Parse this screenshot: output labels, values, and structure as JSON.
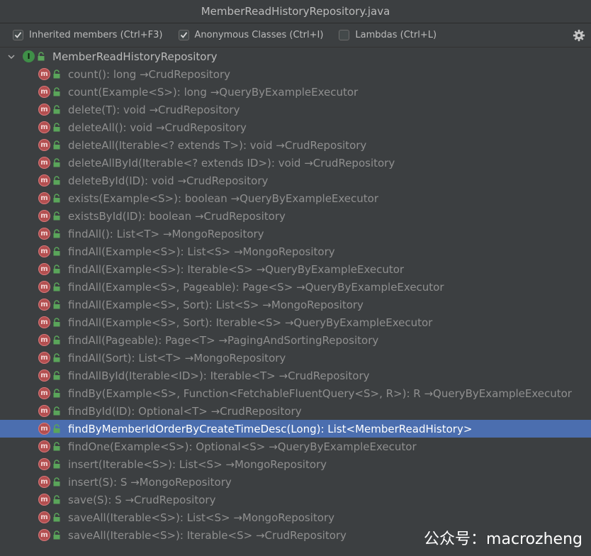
{
  "window": {
    "title": "MemberReadHistoryRepository.java"
  },
  "toolbar": {
    "options": [
      {
        "label": "Inherited members (Ctrl+F3)",
        "checked": true
      },
      {
        "label": "Anonymous Classes (Ctrl+I)",
        "checked": true
      },
      {
        "label": "Lambdas (Ctrl+L)",
        "checked": false
      }
    ],
    "settings_icon": "gear-icon"
  },
  "tree": {
    "root": {
      "label": "MemberReadHistoryRepository",
      "icon": "interface-icon",
      "expanded": true
    },
    "methods": [
      {
        "label": "count(): long →CrudRepository"
      },
      {
        "label": "count(Example<S>): long →QueryByExampleExecutor"
      },
      {
        "label": "delete(T): void →CrudRepository"
      },
      {
        "label": "deleteAll(): void →CrudRepository"
      },
      {
        "label": "deleteAll(Iterable<? extends T>): void →CrudRepository"
      },
      {
        "label": "deleteAllById(Iterable<? extends ID>): void →CrudRepository"
      },
      {
        "label": "deleteById(ID): void →CrudRepository"
      },
      {
        "label": "exists(Example<S>): boolean →QueryByExampleExecutor"
      },
      {
        "label": "existsById(ID): boolean →CrudRepository"
      },
      {
        "label": "findAll(): List<T> →MongoRepository"
      },
      {
        "label": "findAll(Example<S>): List<S> →MongoRepository"
      },
      {
        "label": "findAll(Example<S>): Iterable<S> →QueryByExampleExecutor"
      },
      {
        "label": "findAll(Example<S>, Pageable): Page<S> →QueryByExampleExecutor"
      },
      {
        "label": "findAll(Example<S>, Sort): List<S> →MongoRepository"
      },
      {
        "label": "findAll(Example<S>, Sort): Iterable<S> →QueryByExampleExecutor"
      },
      {
        "label": "findAll(Pageable): Page<T> →PagingAndSortingRepository"
      },
      {
        "label": "findAll(Sort): List<T> →MongoRepository"
      },
      {
        "label": "findAllById(Iterable<ID>): Iterable<T> →CrudRepository"
      },
      {
        "label": "findBy(Example<S>, Function<FetchableFluentQuery<S>, R>): R →QueryByExampleExecutor"
      },
      {
        "label": "findById(ID): Optional<T> →CrudRepository"
      },
      {
        "label": "findByMemberIdOrderByCreateTimeDesc(Long): List<MemberReadHistory>",
        "selected": true
      },
      {
        "label": "findOne(Example<S>): Optional<S> →QueryByExampleExecutor"
      },
      {
        "label": "insert(Iterable<S>): List<S> →MongoRepository"
      },
      {
        "label": "insert(S): S →MongoRepository"
      },
      {
        "label": "save(S): S →CrudRepository"
      },
      {
        "label": "saveAll(Iterable<S>): List<S> →MongoRepository"
      },
      {
        "label": "saveAll(Iterable<S>): Iterable<S> →CrudRepository"
      }
    ],
    "method_icon_letter": "m",
    "interface_icon_letter": "I"
  },
  "watermark": "公众号：macrozheng",
  "colors": {
    "background": "#3c3f41",
    "selection": "#4b6eaf",
    "method_icon": "#b34f50",
    "interface_icon": "#3f8f48",
    "lock_icon": "#4e9a4e"
  }
}
